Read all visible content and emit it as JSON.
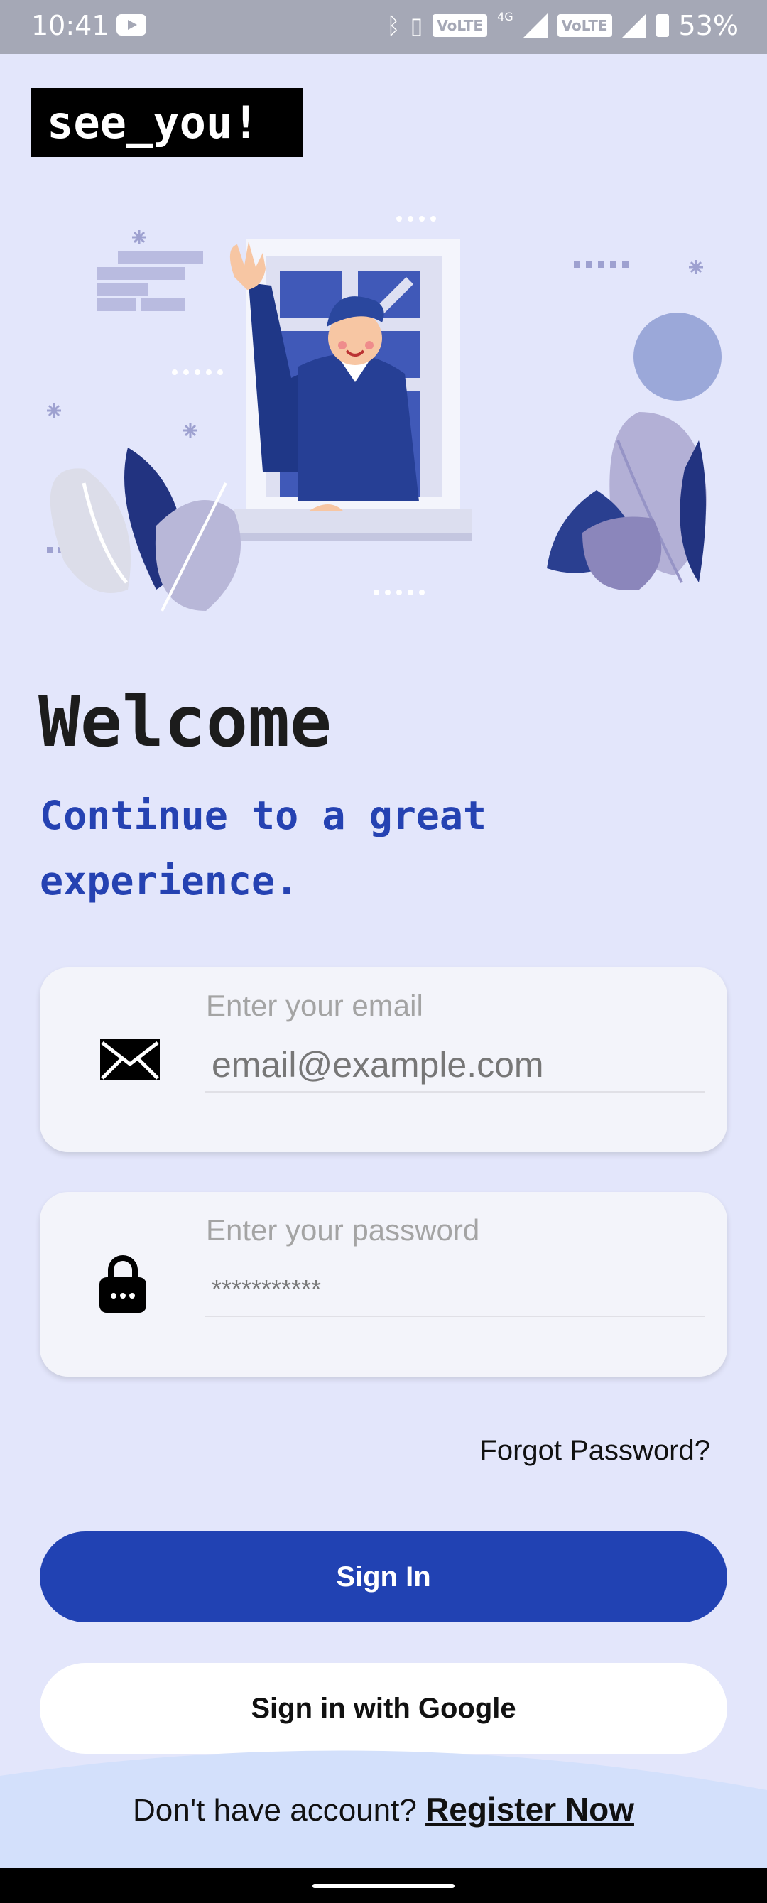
{
  "status_bar": {
    "time": "10:41",
    "network_label_1": "VoLTE",
    "network_type": "4G",
    "network_label_2": "VoLTE",
    "battery": "53%"
  },
  "app": {
    "logo_text": "see_you!"
  },
  "welcome": {
    "title": "Welcome",
    "subtitle": "Continue to a great experience."
  },
  "form": {
    "email": {
      "label": "Enter your email",
      "placeholder": "email@example.com",
      "icon": "envelope-icon"
    },
    "password": {
      "label": "Enter your password",
      "placeholder": "***********",
      "icon": "lock-icon"
    },
    "forgot_password": "Forgot Password?",
    "sign_in": "Sign In",
    "sign_in_google": "Sign in with Google"
  },
  "footer": {
    "no_account_text": "Don't have account?",
    "register_link": "Register Now"
  },
  "colors": {
    "background": "#e3e6fb",
    "primary": "#2142b3",
    "title_blue": "#2542b2",
    "field_bg": "#f3f4fa"
  }
}
